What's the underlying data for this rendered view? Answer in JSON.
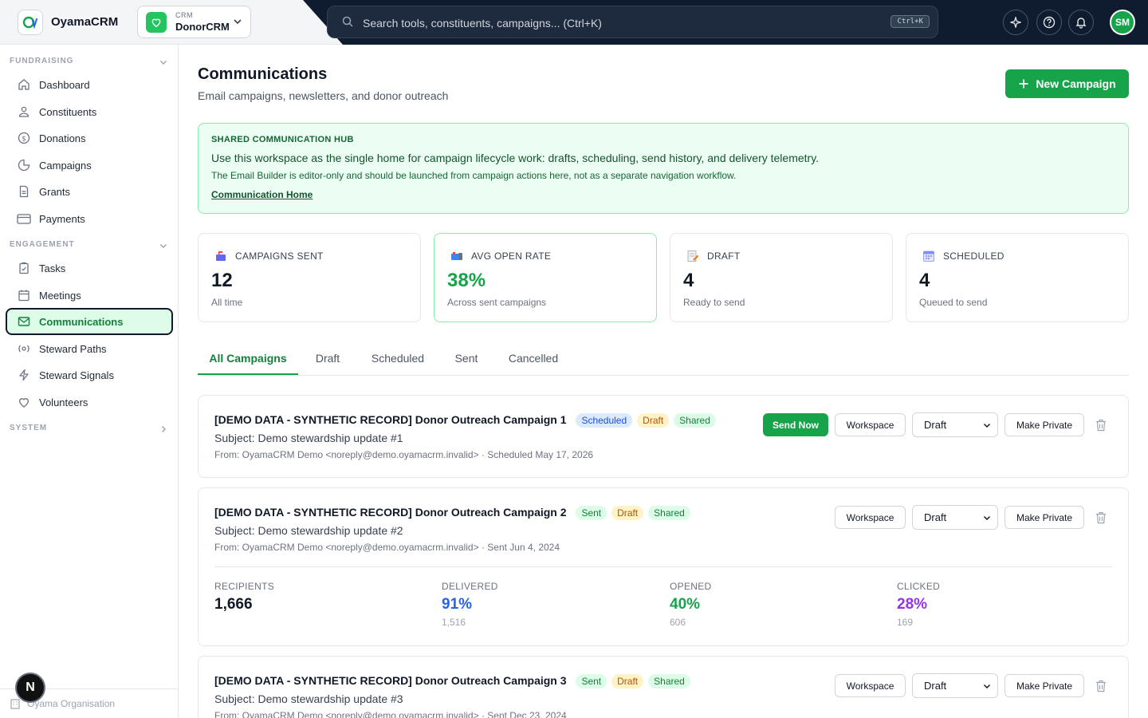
{
  "app": {
    "name": "OyamaCRM"
  },
  "crm_switcher": {
    "eyebrow": "CRM",
    "name": "DonorCRM"
  },
  "search": {
    "placeholder": "Search tools, constituents, campaigns... (Ctrl+K)",
    "shortcut": "Ctrl+K"
  },
  "user": {
    "initials": "SM"
  },
  "sidebar": {
    "sections": [
      {
        "label": "FUNDRAISING",
        "items": [
          {
            "label": "Dashboard",
            "icon": "home-icon"
          },
          {
            "label": "Constituents",
            "icon": "users-icon"
          },
          {
            "label": "Donations",
            "icon": "dollar-icon"
          },
          {
            "label": "Campaigns",
            "icon": "pie-chart-icon"
          },
          {
            "label": "Grants",
            "icon": "document-icon"
          },
          {
            "label": "Payments",
            "icon": "credit-card-icon"
          }
        ]
      },
      {
        "label": "ENGAGEMENT",
        "items": [
          {
            "label": "Tasks",
            "icon": "clipboard-icon"
          },
          {
            "label": "Meetings",
            "icon": "calendar-icon"
          },
          {
            "label": "Communications",
            "icon": "mail-icon",
            "active": true
          },
          {
            "label": "Steward Paths",
            "icon": "radio-icon"
          },
          {
            "label": "Steward Signals",
            "icon": "bolt-icon"
          },
          {
            "label": "Volunteers",
            "icon": "heart-icon"
          }
        ]
      },
      {
        "label": "SYSTEM",
        "items": []
      }
    ],
    "org_name": "Oyama Organisation",
    "floating_badge": "N"
  },
  "page": {
    "title": "Communications",
    "subtitle": "Email campaigns, newsletters, and donor outreach",
    "new_button": "New Campaign"
  },
  "hub": {
    "eyebrow": "SHARED COMMUNICATION HUB",
    "line1": "Use this workspace as the single home for campaign lifecycle work: drafts, scheduling, send history, and delivery telemetry.",
    "line2": "The Email Builder is editor-only and should be launched from campaign actions here, not as a separate navigation workflow.",
    "link": "Communication Home"
  },
  "stats": [
    {
      "label": "CAMPAIGNS SENT",
      "value": "12",
      "sub": "All time",
      "icon": "mailbox-icon"
    },
    {
      "label": "AVG OPEN RATE",
      "value": "38%",
      "sub": "Across sent campaigns",
      "icon": "open-mailbox-icon"
    },
    {
      "label": "DRAFT",
      "value": "4",
      "sub": "Ready to send",
      "icon": "memo-icon"
    },
    {
      "label": "SCHEDULED",
      "value": "4",
      "sub": "Queued to send",
      "icon": "calendar-icon"
    }
  ],
  "tabs": [
    "All Campaigns",
    "Draft",
    "Scheduled",
    "Sent",
    "Cancelled"
  ],
  "campaigns": [
    {
      "title": "[DEMO DATA - SYNTHETIC RECORD] Donor Outreach Campaign 1",
      "badges": [
        "Scheduled",
        "Draft",
        "Shared"
      ],
      "subject": "Subject: Demo stewardship update #1",
      "from": "From: OyamaCRM Demo <noreply@demo.oyamacrm.invalid> · Scheduled May 17, 2026",
      "send_now": "Send Now",
      "workspace": "Workspace",
      "status_select": "Draft",
      "privacy": "Make Private"
    },
    {
      "title": "[DEMO DATA - SYNTHETIC RECORD] Donor Outreach Campaign 2",
      "badges": [
        "Sent",
        "Draft",
        "Shared"
      ],
      "subject": "Subject: Demo stewardship update #2",
      "from": "From: OyamaCRM Demo <noreply@demo.oyamacrm.invalid> · Sent Jun 4, 2024",
      "workspace": "Workspace",
      "status_select": "Draft",
      "privacy": "Make Private",
      "metrics": [
        {
          "label": "RECIPIENTS",
          "value": "1,666",
          "count": ""
        },
        {
          "label": "DELIVERED",
          "value": "91%",
          "count": "1,516"
        },
        {
          "label": "OPENED",
          "value": "40%",
          "count": "606"
        },
        {
          "label": "CLICKED",
          "value": "28%",
          "count": "169"
        }
      ]
    },
    {
      "title": "[DEMO DATA - SYNTHETIC RECORD] Donor Outreach Campaign 3",
      "badges": [
        "Sent",
        "Draft",
        "Shared"
      ],
      "subject": "Subject: Demo stewardship update #3",
      "from": "From: OyamaCRM Demo <noreply@demo.oyamacrm.invalid> · Sent Dec 23, 2024",
      "workspace": "Workspace",
      "status_select": "Draft",
      "privacy": "Make Private"
    }
  ],
  "colors": {
    "accent": "#16a34a",
    "topbar": "#0f1b2e",
    "delivered": "#2563eb",
    "opened": "#16a34a",
    "clicked": "#9333ea"
  }
}
